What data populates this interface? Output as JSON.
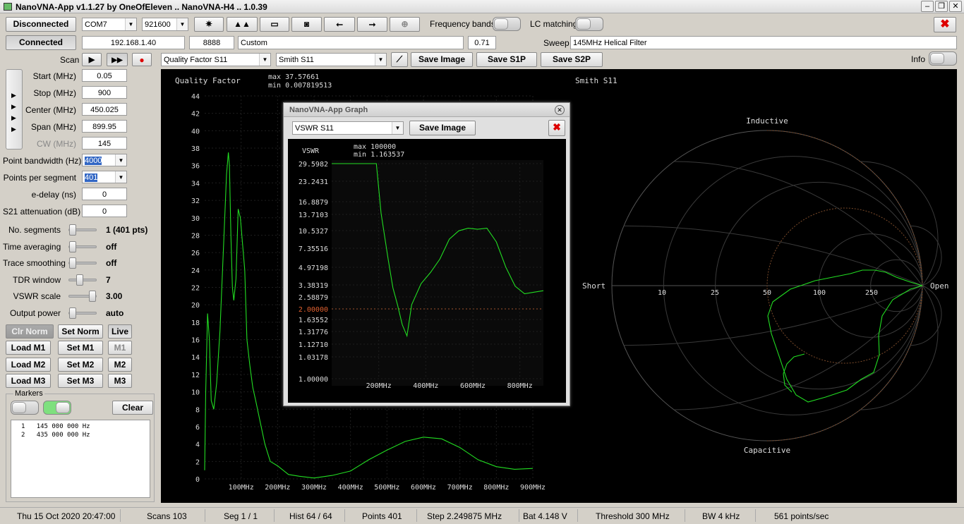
{
  "window": {
    "title": "NanoVNA-App v1.1.27 by OneOfEleven .. NanoVNA-H4 .. 1.0.39"
  },
  "toolbar": {
    "disconnected_label": "Disconnected",
    "connected_label": "Connected",
    "com_port": "COM7",
    "baud": "921600",
    "ip": "192.168.1.40",
    "port": "8888",
    "cal_mode": "Custom",
    "cal_value": "0.71",
    "freq_bands_label": "Frequency bands",
    "lc_matching_label": "LC matching",
    "sweep_name_label": "Sweep name",
    "sweep_name": "145MHz Helical Filter",
    "scan_label": "Scan",
    "trace1_select": "Quality Factor S11",
    "trace2_select": "Smith S11",
    "save_image": "Save Image",
    "save_s1p": "Save S1P",
    "save_s2p": "Save S2P",
    "info_label": "Info"
  },
  "params": {
    "start_label": "Start (MHz)",
    "start": "0.05",
    "stop_label": "Stop (MHz)",
    "stop": "900",
    "center_label": "Center (MHz)",
    "center": "450.025",
    "span_label": "Span (MHz)",
    "span": "899.95",
    "cw_label": "CW (MHz)",
    "cw": "145",
    "pbw_label": "Point bandwidth (Hz)",
    "pbw": "4000",
    "pps_label": "Points per segment",
    "pps": "401",
    "edelay_label": "e-delay (ns)",
    "edelay": "0",
    "s21att_label": "S21 attenuation (dB)",
    "s21att": "0"
  },
  "sliders": [
    {
      "label": "No. segments",
      "value": "1 (401 pts)",
      "pos": 0.0
    },
    {
      "label": "Time averaging",
      "value": "off",
      "pos": 0.0
    },
    {
      "label": "Trace smoothing",
      "value": "off",
      "pos": 0.0
    },
    {
      "label": "TDR window",
      "value": "7",
      "pos": 0.35
    },
    {
      "label": "VSWR scale",
      "value": "3.00",
      "pos": 0.95
    },
    {
      "label": "Output power",
      "value": "auto",
      "pos": 0.0
    }
  ],
  "cal_buttons": {
    "clr_norm": "Clr Norm",
    "set_norm": "Set Norm",
    "live": "Live",
    "load_m1": "Load M1",
    "set_m1": "Set M1",
    "m1": "M1",
    "load_m2": "Load M2",
    "set_m2": "Set M2",
    "m2": "M2",
    "load_m3": "Load M3",
    "set_m3": "Set M3",
    "m3": "M3"
  },
  "markers": {
    "title": "Markers",
    "clear": "Clear",
    "list": [
      {
        "n": "1",
        "freq": "145 000 000 Hz"
      },
      {
        "n": "2",
        "freq": "435 000 000 Hz"
      }
    ]
  },
  "qf_plot": {
    "title": "Quality Factor",
    "max": "max 37.57661",
    "min": "min 0.007819513",
    "trace_color": "#22dd22"
  },
  "smith": {
    "title": "Smith S11",
    "inductive": "Inductive",
    "capacitive": "Capacitive",
    "short": "Short",
    "open": "Open",
    "r_labels": [
      "10",
      "25",
      "50",
      "100",
      "250"
    ]
  },
  "popup": {
    "title": "NanoVNA-App Graph",
    "select": "VSWR S11",
    "save_image": "Save Image",
    "plot_title": "VSWR",
    "max": "max 100000",
    "min": "min 1.163537"
  },
  "status": {
    "datetime": "Thu 15 Oct 2020 20:47:00",
    "scans": "Scans 103",
    "seg": "Seg 1 / 1",
    "hist": "Hist 64 / 64",
    "points": "Points 401",
    "step": "Step 2.249875 MHz",
    "bat": "Bat 4.148 V",
    "threshold": "Threshold 300 MHz",
    "bw": "BW 4 kHz",
    "rate": "561 points/sec"
  },
  "chart_data": [
    {
      "type": "line",
      "title": "Quality Factor",
      "ylim": [
        0,
        44
      ],
      "xlim": [
        0,
        900
      ],
      "y_ticks": [
        "0",
        "2",
        "4",
        "6",
        "8",
        "10",
        "12",
        "14",
        "16",
        "18",
        "20",
        "22",
        "24",
        "26",
        "28",
        "30",
        "32",
        "34",
        "36",
        "38",
        "40",
        "42",
        "44"
      ],
      "x_ticks": [
        "100MHz",
        "200MHz",
        "300MHz",
        "400MHz",
        "500MHz",
        "600MHz",
        "700MHz",
        "800MHz",
        "900MHz"
      ],
      "series": [
        {
          "x": [
            0,
            3,
            8,
            13,
            18,
            25,
            33,
            42,
            52,
            60,
            65,
            68,
            72,
            76,
            80,
            86,
            92,
            98,
            104,
            110,
            116,
            124,
            132,
            140,
            150,
            165,
            180,
            200,
            230,
            260,
            300,
            350,
            400,
            450,
            500,
            550,
            600,
            650,
            700,
            750,
            800,
            850,
            900
          ],
          "y": [
            1,
            10,
            19,
            16,
            9,
            8,
            11,
            17,
            27,
            35,
            37.5,
            36,
            28,
            22,
            20.5,
            23,
            31,
            30,
            27,
            24,
            16,
            13,
            10.5,
            9,
            7,
            4,
            2,
            1.5,
            0.5,
            0.3,
            0.1,
            0.4,
            0.9,
            2.2,
            3.3,
            4.3,
            4.8,
            4.6,
            3.6,
            2.2,
            1.4,
            1.1,
            1.2
          ]
        }
      ]
    },
    {
      "type": "line",
      "title": "VSWR",
      "x_ticks": [
        "200MHz",
        "400MHz",
        "600MHz",
        "800MHz"
      ],
      "y_ticks": [
        "29.5982",
        "23.2431",
        "16.8879",
        "13.7103",
        "10.5327",
        "7.35516",
        "4.97198",
        "3.38319",
        "2.58879",
        "2.00000",
        "1.63552",
        "1.31776",
        "1.12710",
        "1.03178",
        "1.00000"
      ],
      "series": [
        {
          "x": [
            0,
            50,
            100,
            150,
            190,
            210,
            240,
            260,
            280,
            300,
            320,
            340,
            380,
            420,
            460,
            500,
            540,
            580,
            620,
            660,
            700,
            740,
            780,
            820,
            860,
            900
          ],
          "y": [
            29.6,
            29.6,
            29.6,
            29.6,
            29.6,
            14,
            6,
            3.2,
            2.2,
            1.5,
            1.25,
            2.2,
            3.5,
            4.5,
            6,
            9,
            10.5,
            11,
            10.8,
            11,
            8.5,
            5,
            3.3,
            2.8,
            2.9,
            3.0
          ]
        }
      ]
    }
  ]
}
